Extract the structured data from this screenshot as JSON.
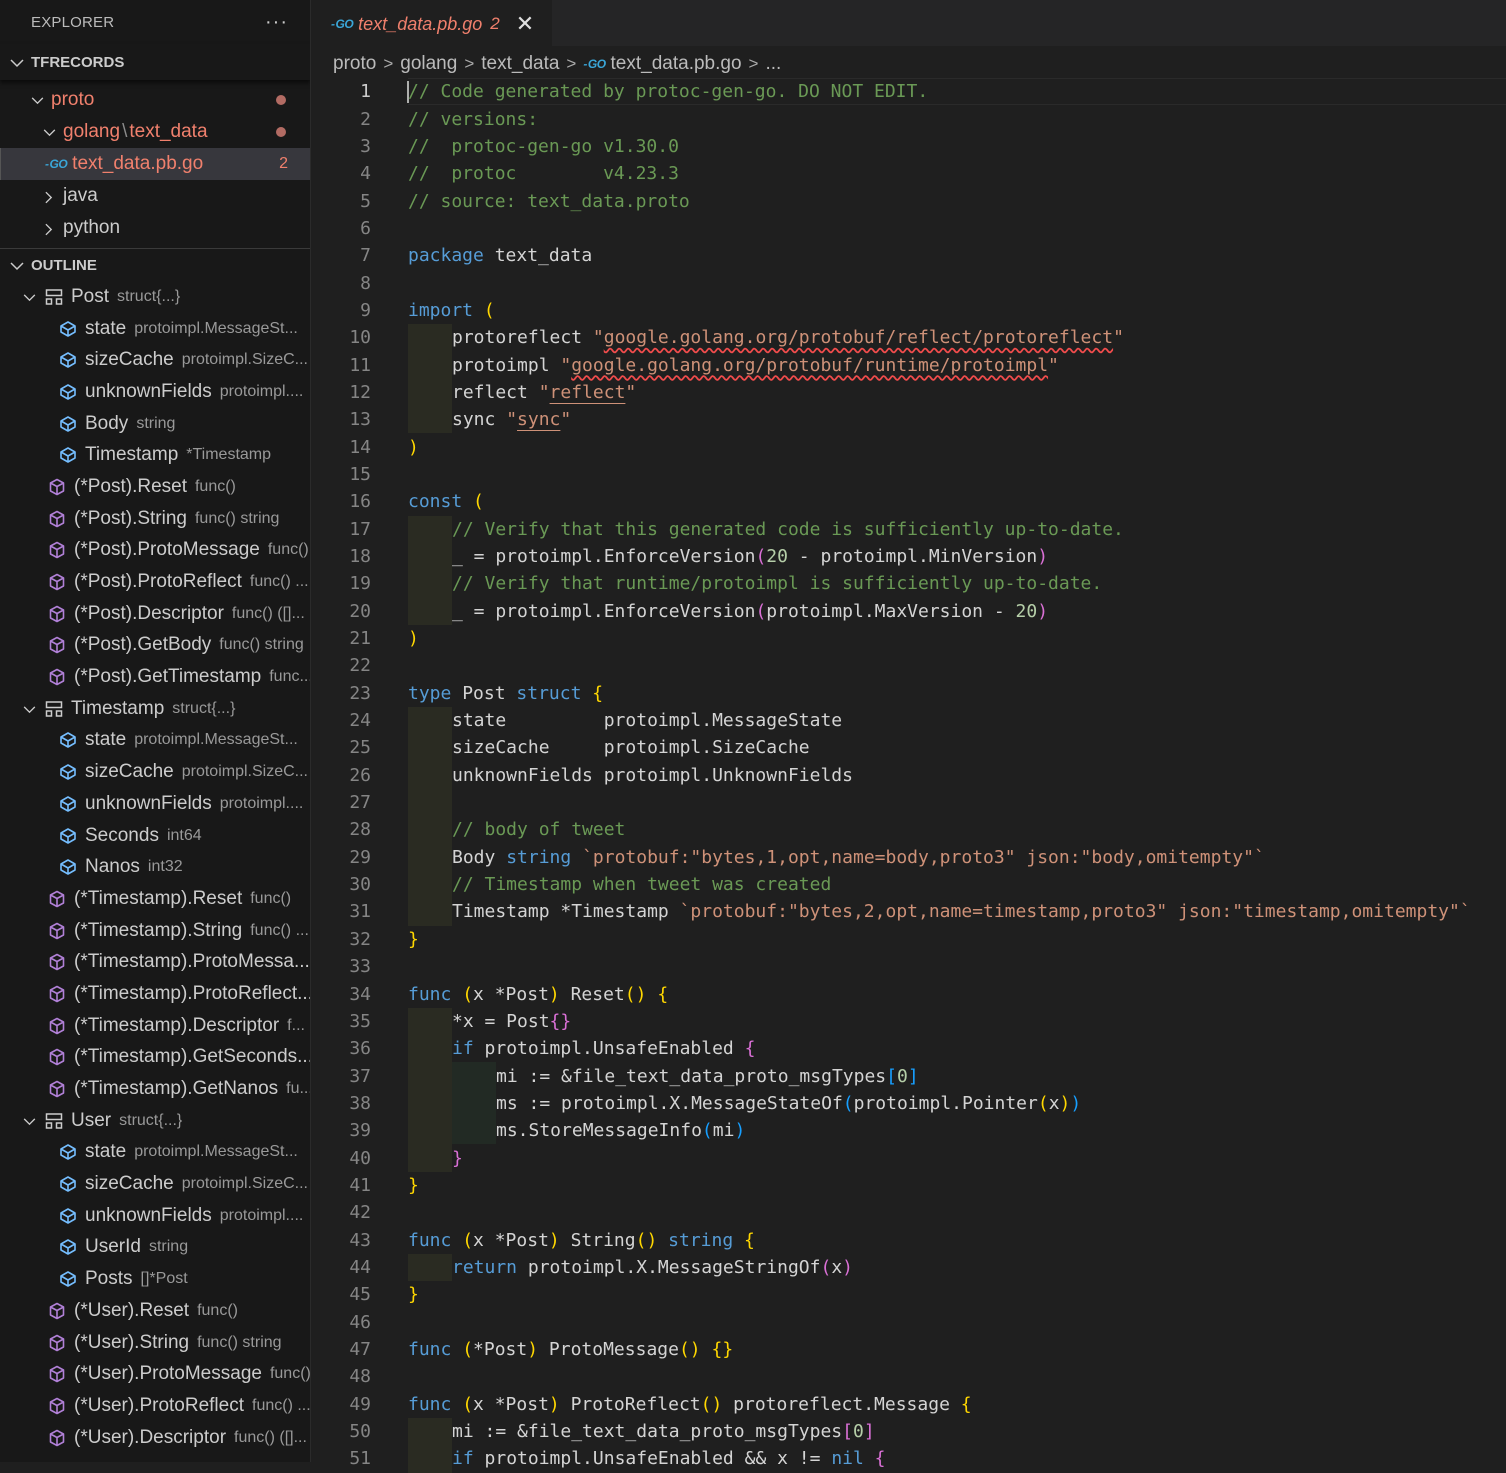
{
  "sidebar": {
    "title": "EXPLORER",
    "more_label": "···",
    "workspace": "TFRECORDS",
    "tree": [
      {
        "label": "proto",
        "level": 1,
        "expanded": true,
        "modified": true
      },
      {
        "label_a": "golang",
        "label_b": "text_data",
        "level": 2,
        "expanded": true,
        "modified": true
      },
      {
        "label": "text_data.pb.go",
        "level": 3,
        "selected": true,
        "modified": true,
        "badge": "2",
        "icon": "go-file-icon"
      },
      {
        "label": "java",
        "level": 2,
        "expanded": false
      },
      {
        "label": "python",
        "level": 2,
        "expanded": false
      }
    ],
    "outline_title": "OUTLINE",
    "outline": [
      {
        "kind": "struct",
        "name": "Post",
        "detail": "struct{...}",
        "level": 1
      },
      {
        "kind": "field",
        "name": "state",
        "detail": "protoimpl.MessageSt...",
        "level": 2
      },
      {
        "kind": "field",
        "name": "sizeCache",
        "detail": "protoimpl.SizeC...",
        "level": 2
      },
      {
        "kind": "field",
        "name": "unknownFields",
        "detail": "protoimpl....",
        "level": 2
      },
      {
        "kind": "field",
        "name": "Body",
        "detail": "string",
        "level": 2
      },
      {
        "kind": "field",
        "name": "Timestamp",
        "detail": "*Timestamp",
        "level": 2
      },
      {
        "kind": "method",
        "name": "(*Post).Reset",
        "detail": "func()",
        "level": 1
      },
      {
        "kind": "method",
        "name": "(*Post).String",
        "detail": "func() string",
        "level": 1
      },
      {
        "kind": "method",
        "name": "(*Post).ProtoMessage",
        "detail": "func()",
        "level": 1
      },
      {
        "kind": "method",
        "name": "(*Post).ProtoReflect",
        "detail": "func() ...",
        "level": 1
      },
      {
        "kind": "method",
        "name": "(*Post).Descriptor",
        "detail": "func() ([]...",
        "level": 1
      },
      {
        "kind": "method",
        "name": "(*Post).GetBody",
        "detail": "func() string",
        "level": 1
      },
      {
        "kind": "method",
        "name": "(*Post).GetTimestamp",
        "detail": "func...",
        "level": 1
      },
      {
        "kind": "struct",
        "name": "Timestamp",
        "detail": "struct{...}",
        "level": 1
      },
      {
        "kind": "field",
        "name": "state",
        "detail": "protoimpl.MessageSt...",
        "level": 2
      },
      {
        "kind": "field",
        "name": "sizeCache",
        "detail": "protoimpl.SizeC...",
        "level": 2
      },
      {
        "kind": "field",
        "name": "unknownFields",
        "detail": "protoimpl....",
        "level": 2
      },
      {
        "kind": "field",
        "name": "Seconds",
        "detail": "int64",
        "level": 2
      },
      {
        "kind": "field",
        "name": "Nanos",
        "detail": "int32",
        "level": 2
      },
      {
        "kind": "method",
        "name": "(*Timestamp).Reset",
        "detail": "func()",
        "level": 1
      },
      {
        "kind": "method",
        "name": "(*Timestamp).String",
        "detail": "func() ...",
        "level": 1
      },
      {
        "kind": "method",
        "name": "(*Timestamp).ProtoMessa...",
        "detail": "",
        "level": 1
      },
      {
        "kind": "method",
        "name": "(*Timestamp).ProtoReflect...",
        "detail": "",
        "level": 1
      },
      {
        "kind": "method",
        "name": "(*Timestamp).Descriptor",
        "detail": "f...",
        "level": 1
      },
      {
        "kind": "method",
        "name": "(*Timestamp).GetSeconds...",
        "detail": "",
        "level": 1
      },
      {
        "kind": "method",
        "name": "(*Timestamp).GetNanos",
        "detail": "fu...",
        "level": 1
      },
      {
        "kind": "struct",
        "name": "User",
        "detail": "struct{...}",
        "level": 1
      },
      {
        "kind": "field",
        "name": "state",
        "detail": "protoimpl.MessageSt...",
        "level": 2
      },
      {
        "kind": "field",
        "name": "sizeCache",
        "detail": "protoimpl.SizeC...",
        "level": 2
      },
      {
        "kind": "field",
        "name": "unknownFields",
        "detail": "protoimpl....",
        "level": 2
      },
      {
        "kind": "field",
        "name": "UserId",
        "detail": "string",
        "level": 2
      },
      {
        "kind": "field",
        "name": "Posts",
        "detail": "[]*Post",
        "level": 2
      },
      {
        "kind": "method",
        "name": "(*User).Reset",
        "detail": "func()",
        "level": 1
      },
      {
        "kind": "method",
        "name": "(*User).String",
        "detail": "func() string",
        "level": 1
      },
      {
        "kind": "method",
        "name": "(*User).ProtoMessage",
        "detail": "func()",
        "level": 1
      },
      {
        "kind": "method",
        "name": "(*User).ProtoReflect",
        "detail": "func() ...",
        "level": 1
      },
      {
        "kind": "method",
        "name": "(*User).Descriptor",
        "detail": "func() ([]...",
        "level": 1
      }
    ]
  },
  "tab": {
    "icon": "go-file-icon",
    "label": "text_data.pb.go",
    "problems": "2",
    "close": "✕"
  },
  "breadcrumb": [
    "proto",
    "golang",
    "text_data",
    "text_data.pb.go",
    "..."
  ],
  "colors": {
    "comment": "#6a9955",
    "keyword": "#569cd6",
    "string": "#ce9178",
    "number": "#b5cea8",
    "modified": "#f0806d",
    "go_icon": "#3aa6d8",
    "field_icon": "#75beff",
    "method_icon": "#b180d7"
  },
  "code": {
    "current_line": 1,
    "lines": [
      [
        [
          0,
          "cm",
          "// Code generated by protoc-gen-go. DO NOT EDIT."
        ]
      ],
      [
        [
          0,
          "cm",
          "// versions:"
        ]
      ],
      [
        [
          0,
          "cm",
          "// \tprotoc-gen-go v1.30.0"
        ]
      ],
      [
        [
          0,
          "cm",
          "// \tprotoc        v4.23.3"
        ]
      ],
      [
        [
          0,
          "cm",
          "// source: text_data.proto"
        ]
      ],
      [],
      [
        [
          0,
          "kw",
          "package"
        ],
        [
          0,
          "id",
          " text_data"
        ]
      ],
      [],
      [
        [
          0,
          "kw",
          "import"
        ],
        [
          0,
          "id",
          " "
        ],
        [
          0,
          "b1",
          "("
        ]
      ],
      [
        [
          1,
          "id",
          "protoreflect "
        ],
        [
          1,
          "str",
          "\""
        ],
        [
          1,
          "str squig",
          "google.golang.org/protobuf/reflect/protoreflect"
        ],
        [
          1,
          "str",
          "\""
        ]
      ],
      [
        [
          1,
          "id",
          "protoimpl "
        ],
        [
          1,
          "str",
          "\""
        ],
        [
          1,
          "str squig",
          "google.golang.org/protobuf/runtime/protoimpl"
        ],
        [
          1,
          "str",
          "\""
        ]
      ],
      [
        [
          1,
          "id",
          "reflect "
        ],
        [
          1,
          "str",
          "\""
        ],
        [
          1,
          "str uline",
          "reflect"
        ],
        [
          1,
          "str",
          "\""
        ]
      ],
      [
        [
          1,
          "id",
          "sync "
        ],
        [
          1,
          "str",
          "\""
        ],
        [
          1,
          "str uline",
          "sync"
        ],
        [
          1,
          "str",
          "\""
        ]
      ],
      [
        [
          0,
          "b1",
          ")"
        ]
      ],
      [],
      [
        [
          0,
          "kw",
          "const"
        ],
        [
          0,
          "id",
          " "
        ],
        [
          0,
          "b1",
          "("
        ]
      ],
      [
        [
          1,
          "cm",
          "// Verify that this generated code is sufficiently up-to-date."
        ]
      ],
      [
        [
          1,
          "id",
          "_ = protoimpl.EnforceVersion"
        ],
        [
          1,
          "b2",
          "("
        ],
        [
          1,
          "num",
          "20"
        ],
        [
          1,
          "id",
          " - protoimpl.MinVersion"
        ],
        [
          1,
          "b2",
          ")"
        ]
      ],
      [
        [
          1,
          "cm",
          "// Verify that runtime/protoimpl is sufficiently up-to-date."
        ]
      ],
      [
        [
          1,
          "id",
          "_ = protoimpl.EnforceVersion"
        ],
        [
          1,
          "b2",
          "("
        ],
        [
          1,
          "id",
          "protoimpl.MaxVersion - "
        ],
        [
          1,
          "num",
          "20"
        ],
        [
          1,
          "b2",
          ")"
        ]
      ],
      [
        [
          0,
          "b1",
          ")"
        ]
      ],
      [],
      [
        [
          0,
          "kw",
          "type"
        ],
        [
          0,
          "id",
          " Post "
        ],
        [
          0,
          "kw",
          "struct"
        ],
        [
          0,
          "id",
          " "
        ],
        [
          0,
          "b1",
          "{"
        ]
      ],
      [
        [
          1,
          "id",
          "state         protoimpl.MessageState"
        ]
      ],
      [
        [
          1,
          "id",
          "sizeCache     protoimpl.SizeCache"
        ]
      ],
      [
        [
          1,
          "id",
          "unknownFields protoimpl.UnknownFields"
        ]
      ],
      [
        [
          1,
          "id",
          ""
        ]
      ],
      [
        [
          1,
          "cm",
          "// body of tweet"
        ]
      ],
      [
        [
          1,
          "id",
          "Body "
        ],
        [
          1,
          "kw",
          "string"
        ],
        [
          1,
          "id",
          " "
        ],
        [
          1,
          "str",
          "`protobuf:\"bytes,1,opt,name=body,proto3\" json:\"body,omitempty\"`"
        ]
      ],
      [
        [
          1,
          "cm",
          "// Timestamp when tweet was created"
        ]
      ],
      [
        [
          1,
          "id",
          "Timestamp *Timestamp "
        ],
        [
          1,
          "str",
          "`protobuf:\"bytes,2,opt,name=timestamp,proto3\" json:\"timestamp,omitempty\"`"
        ]
      ],
      [
        [
          0,
          "b1",
          "}"
        ]
      ],
      [],
      [
        [
          0,
          "kw",
          "func"
        ],
        [
          0,
          "id",
          " "
        ],
        [
          0,
          "b1",
          "("
        ],
        [
          0,
          "id",
          "x *Post"
        ],
        [
          0,
          "b1",
          ")"
        ],
        [
          0,
          "id",
          " Reset"
        ],
        [
          0,
          "b1",
          "()"
        ],
        [
          0,
          "id",
          " "
        ],
        [
          0,
          "b1",
          "{"
        ]
      ],
      [
        [
          1,
          "id",
          "*x = Post"
        ],
        [
          1,
          "b2",
          "{}"
        ]
      ],
      [
        [
          1,
          "kw",
          "if"
        ],
        [
          1,
          "id",
          " protoimpl.UnsafeEnabled "
        ],
        [
          1,
          "b2",
          "{"
        ]
      ],
      [
        [
          2,
          "id",
          "mi := &file_text_data_proto_msgTypes"
        ],
        [
          2,
          "b3",
          "["
        ],
        [
          2,
          "num",
          "0"
        ],
        [
          2,
          "b3",
          "]"
        ]
      ],
      [
        [
          2,
          "id",
          "ms := protoimpl.X.MessageStateOf"
        ],
        [
          2,
          "b3",
          "("
        ],
        [
          2,
          "id",
          "protoimpl.Pointer"
        ],
        [
          2,
          "b1",
          "("
        ],
        [
          2,
          "id",
          "x"
        ],
        [
          2,
          "b1",
          ")"
        ],
        [
          2,
          "b3",
          ")"
        ]
      ],
      [
        [
          2,
          "id",
          "ms.StoreMessageInfo"
        ],
        [
          2,
          "b3",
          "("
        ],
        [
          2,
          "id",
          "mi"
        ],
        [
          2,
          "b3",
          ")"
        ]
      ],
      [
        [
          1,
          "b2",
          "}"
        ]
      ],
      [
        [
          0,
          "b1",
          "}"
        ]
      ],
      [],
      [
        [
          0,
          "kw",
          "func"
        ],
        [
          0,
          "id",
          " "
        ],
        [
          0,
          "b1",
          "("
        ],
        [
          0,
          "id",
          "x *Post"
        ],
        [
          0,
          "b1",
          ")"
        ],
        [
          0,
          "id",
          " String"
        ],
        [
          0,
          "b1",
          "()"
        ],
        [
          0,
          "id",
          " "
        ],
        [
          0,
          "kw",
          "string"
        ],
        [
          0,
          "id",
          " "
        ],
        [
          0,
          "b1",
          "{"
        ]
      ],
      [
        [
          1,
          "kw",
          "return"
        ],
        [
          1,
          "id",
          " protoimpl.X.MessageStringOf"
        ],
        [
          1,
          "b2",
          "("
        ],
        [
          1,
          "id",
          "x"
        ],
        [
          1,
          "b2",
          ")"
        ]
      ],
      [
        [
          0,
          "b1",
          "}"
        ]
      ],
      [],
      [
        [
          0,
          "kw",
          "func"
        ],
        [
          0,
          "id",
          " "
        ],
        [
          0,
          "b1",
          "("
        ],
        [
          0,
          "id",
          "*Post"
        ],
        [
          0,
          "b1",
          ")"
        ],
        [
          0,
          "id",
          " ProtoMessage"
        ],
        [
          0,
          "b1",
          "()"
        ],
        [
          0,
          "id",
          " "
        ],
        [
          0,
          "b1",
          "{}"
        ]
      ],
      [],
      [
        [
          0,
          "kw",
          "func"
        ],
        [
          0,
          "id",
          " "
        ],
        [
          0,
          "b1",
          "("
        ],
        [
          0,
          "id",
          "x *Post"
        ],
        [
          0,
          "b1",
          ")"
        ],
        [
          0,
          "id",
          " ProtoReflect"
        ],
        [
          0,
          "b1",
          "()"
        ],
        [
          0,
          "id",
          " protoreflect.Message "
        ],
        [
          0,
          "b1",
          "{"
        ]
      ],
      [
        [
          1,
          "id",
          "mi := &file_text_data_proto_msgTypes"
        ],
        [
          1,
          "b2",
          "["
        ],
        [
          1,
          "num",
          "0"
        ],
        [
          1,
          "b2",
          "]"
        ]
      ],
      [
        [
          1,
          "kw",
          "if"
        ],
        [
          1,
          "id",
          " protoimpl.UnsafeEnabled && x != "
        ],
        [
          1,
          "kw",
          "nil"
        ],
        [
          1,
          "id",
          " "
        ],
        [
          1,
          "b2",
          "{"
        ]
      ]
    ]
  }
}
